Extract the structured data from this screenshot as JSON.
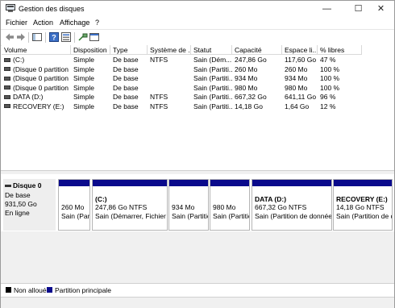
{
  "window": {
    "title": "Gestion des disques",
    "controls": [
      "—",
      "☐",
      "✕"
    ]
  },
  "menu": [
    "Fichier",
    "Action",
    "Affichage",
    "?"
  ],
  "toolbar_icons": [
    "back-arrow-icon",
    "forward-arrow-icon",
    "console-tree-icon",
    "help-icon",
    "properties-icon",
    "connect-icon",
    "view-icon"
  ],
  "columns": [
    "Volume",
    "Disposition",
    "Type",
    "Système de ...",
    "Statut",
    "Capacité",
    "Espace li...",
    "% libres"
  ],
  "volumes": [
    {
      "volume": "(C:)",
      "disposition": "Simple",
      "type": "De base",
      "fs": "NTFS",
      "statut": "Sain (Dém...",
      "capacite": "247,86 Go",
      "espace": "117,60 Go",
      "libres": "47 %"
    },
    {
      "volume": "(Disque 0 partition ...",
      "disposition": "Simple",
      "type": "De base",
      "fs": "",
      "statut": "Sain (Partiti...",
      "capacite": "260 Mo",
      "espace": "260 Mo",
      "libres": "100 %"
    },
    {
      "volume": "(Disque 0 partition ...",
      "disposition": "Simple",
      "type": "De base",
      "fs": "",
      "statut": "Sain (Partiti...",
      "capacite": "934 Mo",
      "espace": "934 Mo",
      "libres": "100 %"
    },
    {
      "volume": "(Disque 0 partition ...",
      "disposition": "Simple",
      "type": "De base",
      "fs": "",
      "statut": "Sain (Partiti...",
      "capacite": "980 Mo",
      "espace": "980 Mo",
      "libres": "100 %"
    },
    {
      "volume": "DATA (D:)",
      "disposition": "Simple",
      "type": "De base",
      "fs": "NTFS",
      "statut": "Sain (Partiti...",
      "capacite": "667,32 Go",
      "espace": "641,11 Go",
      "libres": "96 %"
    },
    {
      "volume": "RECOVERY (E:)",
      "disposition": "Simple",
      "type": "De base",
      "fs": "NTFS",
      "statut": "Sain (Partiti...",
      "capacite": "14,18 Go",
      "espace": "1,64 Go",
      "libres": "12 %"
    }
  ],
  "disk": {
    "name": "Disque 0",
    "kind": "De base",
    "size": "931,50 Go",
    "state": "En ligne"
  },
  "partitions": [
    {
      "title": "",
      "size": "260 Mo",
      "status": "Sain (Part"
    },
    {
      "title": "(C:)",
      "size": "247,86 Go NTFS",
      "status": "Sain (Démarrer, Fichier d"
    },
    {
      "title": "",
      "size": "934 Mo",
      "status": "Sain (Partitio"
    },
    {
      "title": "",
      "size": "980 Mo",
      "status": "Sain (Partitio"
    },
    {
      "title": "DATA  (D:)",
      "size": "667,32 Go NTFS",
      "status": "Sain (Partition de données"
    },
    {
      "title": "RECOVERY  (E:)",
      "size": "14,18 Go NTFS",
      "status": "Sain (Partition de d"
    }
  ],
  "legend": [
    {
      "label": "Non alloué",
      "color": "#000000"
    },
    {
      "label": "Partition principale",
      "color": "#0a0a8c"
    }
  ]
}
